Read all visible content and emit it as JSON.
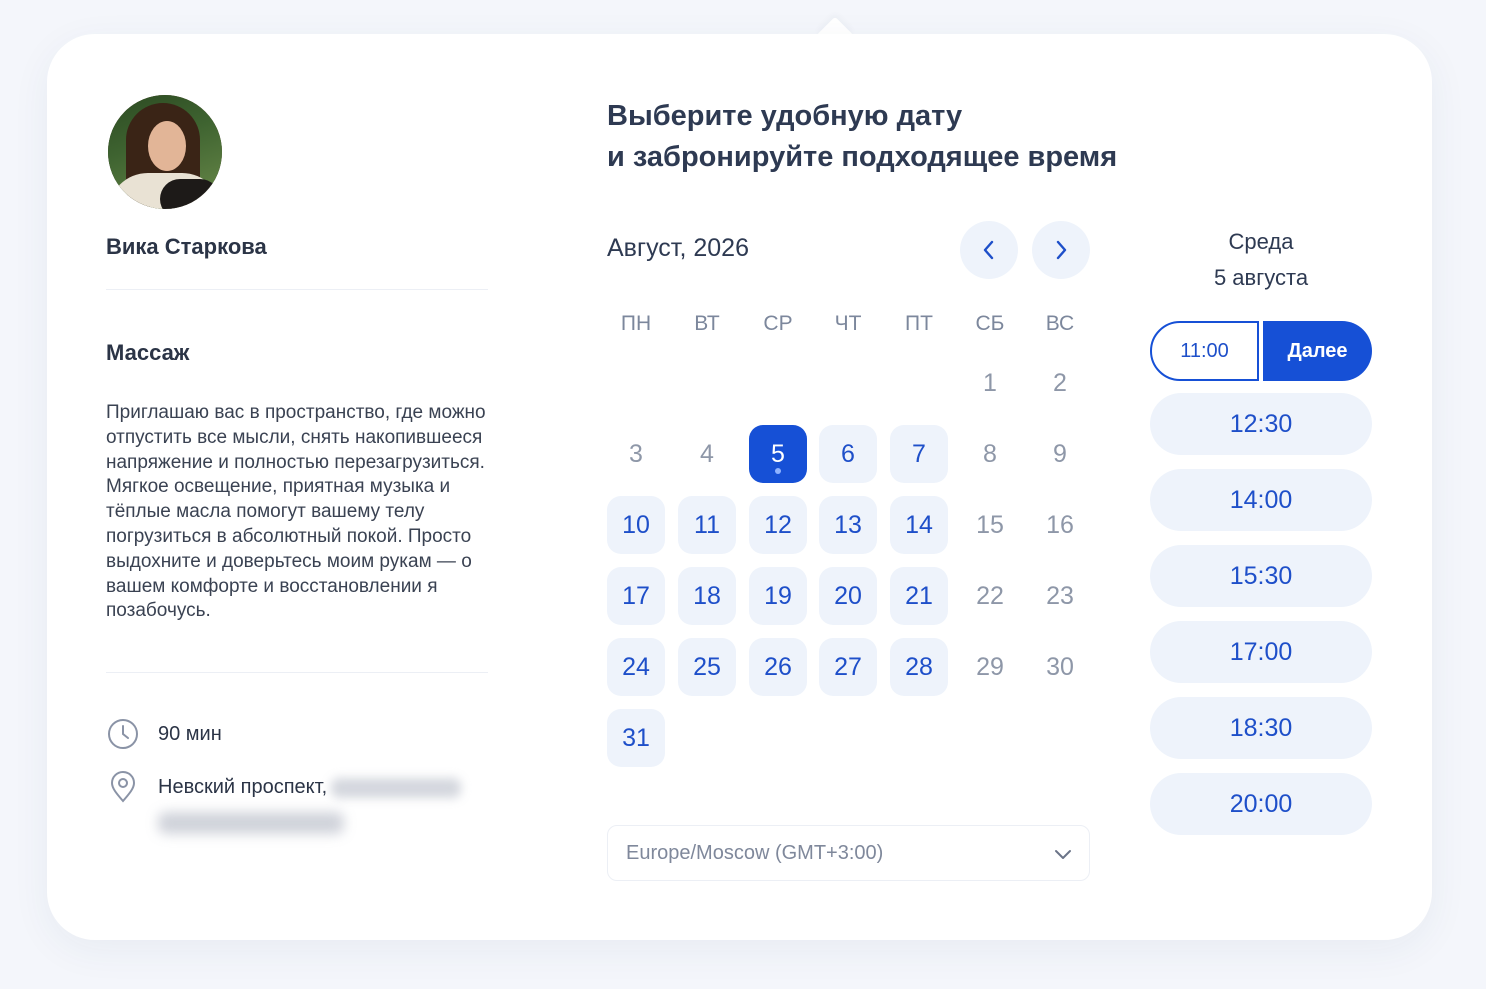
{
  "host": {
    "name": "Вика Старкова"
  },
  "service": {
    "title": "Массаж",
    "description": "Приглашаю вас в пространство, где можно отпустить все мысли, снять накопившееся напряжение и полностью перезагрузиться. Мягкое освещение, приятная музыка и тёплые масла помогут вашему телу погрузиться в абсолютный покой. Просто выдохните и доверьтесь моим рукам — о вашем комфорте и восстановлении я позабочусь.",
    "duration": "90 мин",
    "address": "Невский проспект,"
  },
  "heading": {
    "line1": "Выберите удобную дату",
    "line2": "и забронируйте подходящее время"
  },
  "calendar": {
    "month_label": "Август, 2026",
    "weekdays": [
      "ПН",
      "ВТ",
      "СР",
      "ЧТ",
      "ПТ",
      "СБ",
      "ВС"
    ],
    "days": [
      {
        "label": "1",
        "col": 5,
        "row": 0,
        "state": "plain"
      },
      {
        "label": "2",
        "col": 6,
        "row": 0,
        "state": "plain"
      },
      {
        "label": "3",
        "col": 0,
        "row": 1,
        "state": "plain"
      },
      {
        "label": "4",
        "col": 1,
        "row": 1,
        "state": "plain"
      },
      {
        "label": "5",
        "col": 2,
        "row": 1,
        "state": "selected"
      },
      {
        "label": "6",
        "col": 3,
        "row": 1,
        "state": "available"
      },
      {
        "label": "7",
        "col": 4,
        "row": 1,
        "state": "available"
      },
      {
        "label": "8",
        "col": 5,
        "row": 1,
        "state": "plain"
      },
      {
        "label": "9",
        "col": 6,
        "row": 1,
        "state": "plain"
      },
      {
        "label": "10",
        "col": 0,
        "row": 2,
        "state": "available"
      },
      {
        "label": "11",
        "col": 1,
        "row": 2,
        "state": "available"
      },
      {
        "label": "12",
        "col": 2,
        "row": 2,
        "state": "available"
      },
      {
        "label": "13",
        "col": 3,
        "row": 2,
        "state": "available"
      },
      {
        "label": "14",
        "col": 4,
        "row": 2,
        "state": "available"
      },
      {
        "label": "15",
        "col": 5,
        "row": 2,
        "state": "plain"
      },
      {
        "label": "16",
        "col": 6,
        "row": 2,
        "state": "plain"
      },
      {
        "label": "17",
        "col": 0,
        "row": 3,
        "state": "available"
      },
      {
        "label": "18",
        "col": 1,
        "row": 3,
        "state": "available"
      },
      {
        "label": "19",
        "col": 2,
        "row": 3,
        "state": "available"
      },
      {
        "label": "20",
        "col": 3,
        "row": 3,
        "state": "available"
      },
      {
        "label": "21",
        "col": 4,
        "row": 3,
        "state": "available"
      },
      {
        "label": "22",
        "col": 5,
        "row": 3,
        "state": "plain"
      },
      {
        "label": "23",
        "col": 6,
        "row": 3,
        "state": "plain"
      },
      {
        "label": "24",
        "col": 0,
        "row": 4,
        "state": "available"
      },
      {
        "label": "25",
        "col": 1,
        "row": 4,
        "state": "available"
      },
      {
        "label": "26",
        "col": 2,
        "row": 4,
        "state": "available"
      },
      {
        "label": "27",
        "col": 3,
        "row": 4,
        "state": "available"
      },
      {
        "label": "28",
        "col": 4,
        "row": 4,
        "state": "available"
      },
      {
        "label": "29",
        "col": 5,
        "row": 4,
        "state": "plain"
      },
      {
        "label": "30",
        "col": 6,
        "row": 4,
        "state": "plain"
      },
      {
        "label": "31",
        "col": 0,
        "row": 5,
        "state": "available"
      }
    ]
  },
  "timezone": {
    "value": "Europe/Moscow (GMT+3:00)"
  },
  "schedule": {
    "weekday": "Среда",
    "date": "5 августа",
    "selected_time": "11:00",
    "next_label": "Далее",
    "slots": [
      "12:30",
      "14:00",
      "15:30",
      "17:00",
      "18:30",
      "20:00"
    ]
  },
  "colors": {
    "accent": "#1650d6",
    "available_bg": "#eef3fb",
    "text_primary": "#2e3a52"
  },
  "icons": {
    "prev": "chevron-left-icon",
    "next": "chevron-right-icon",
    "duration": "clock-icon",
    "location": "map-pin-icon",
    "timezone": "chevron-down-icon"
  }
}
